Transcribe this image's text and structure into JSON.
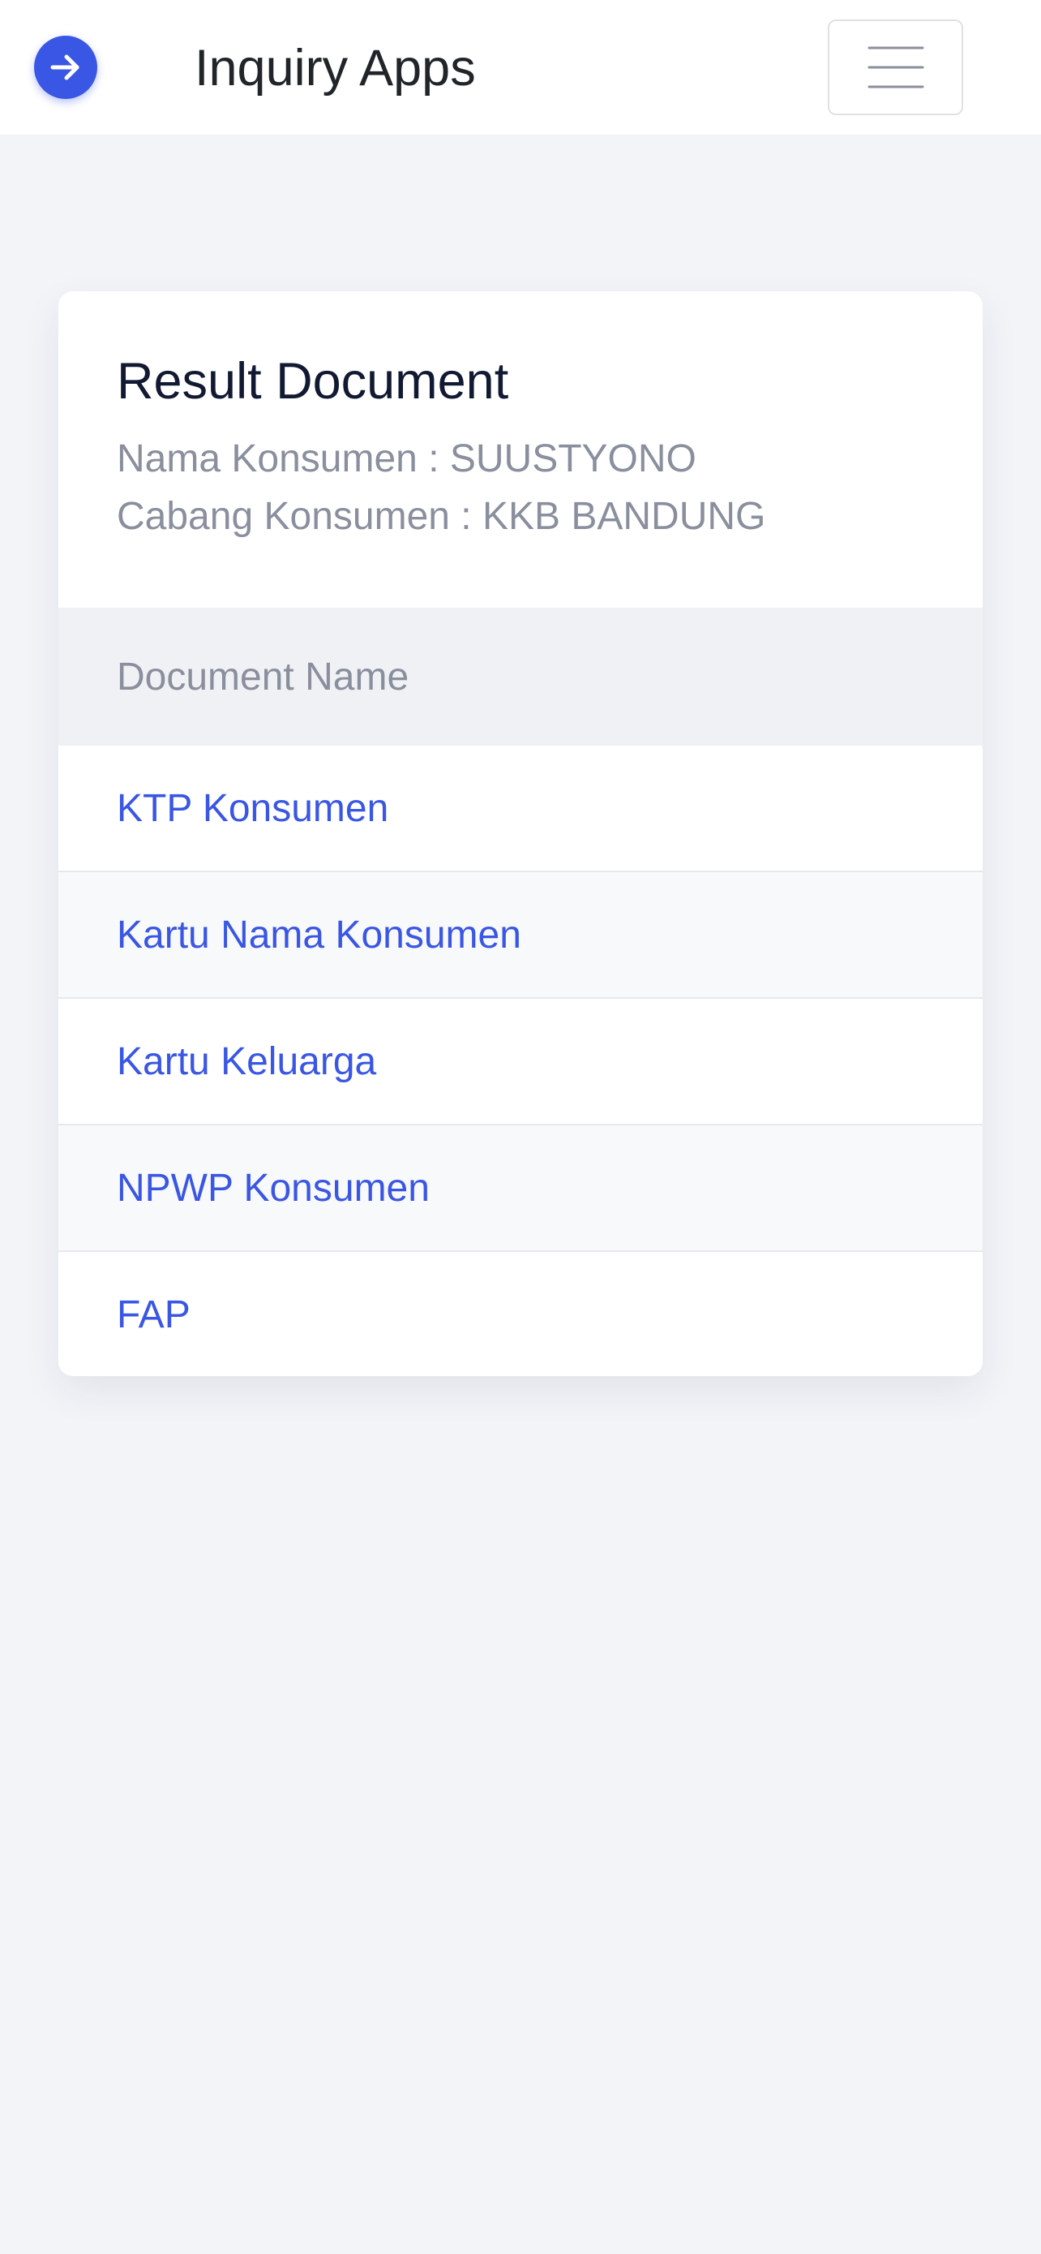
{
  "navbar": {
    "brand_icon": "arrow-right-circle-icon",
    "title": "Inquiry Apps",
    "menu_icon": "hamburger-menu-icon"
  },
  "card": {
    "title": "Result Document",
    "customer_name_line": "Nama Konsumen : SUUSTYONO",
    "customer_branch_line": "Cabang Konsumen : KKB BANDUNG",
    "table": {
      "header": "Document Name",
      "rows": [
        "KTP Konsumen",
        "Kartu Nama Konsumen",
        "Kartu Keluarga",
        "NPWP Konsumen",
        "FAP"
      ]
    }
  },
  "colors": {
    "accent": "#3a56e4",
    "background": "#f3f4f8",
    "muted_text": "#8a8f9e"
  }
}
